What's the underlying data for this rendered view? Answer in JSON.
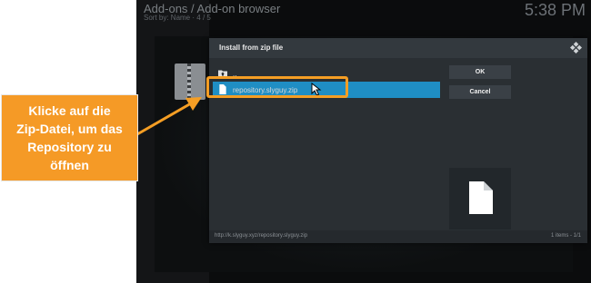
{
  "app": {
    "title": "Add-ons / Add-on browser",
    "sort_label": "Sort by: Name",
    "sort_count": "4 / 5",
    "clock": "5:38 PM"
  },
  "dialog": {
    "title": "Install from zip file",
    "items": [
      {
        "label": "..",
        "icon": "folder-up-icon"
      },
      {
        "label": "repository.slyguy.zip",
        "icon": "file-icon",
        "selected": true
      }
    ],
    "ok_label": "OK",
    "cancel_label": "Cancel",
    "footer_path": "http://k.slyguy.xyz/repository.slyguy.zip",
    "footer_count": "1 items - 1/1"
  },
  "annotation": {
    "text_lines": [
      "Klicke auf die",
      "Zip-Datei, um das",
      "Repository zu",
      "öffnen"
    ],
    "color": "#f59e24"
  },
  "colors": {
    "selection": "#1f8ec4",
    "dialog_bg": "#2a2f33"
  }
}
